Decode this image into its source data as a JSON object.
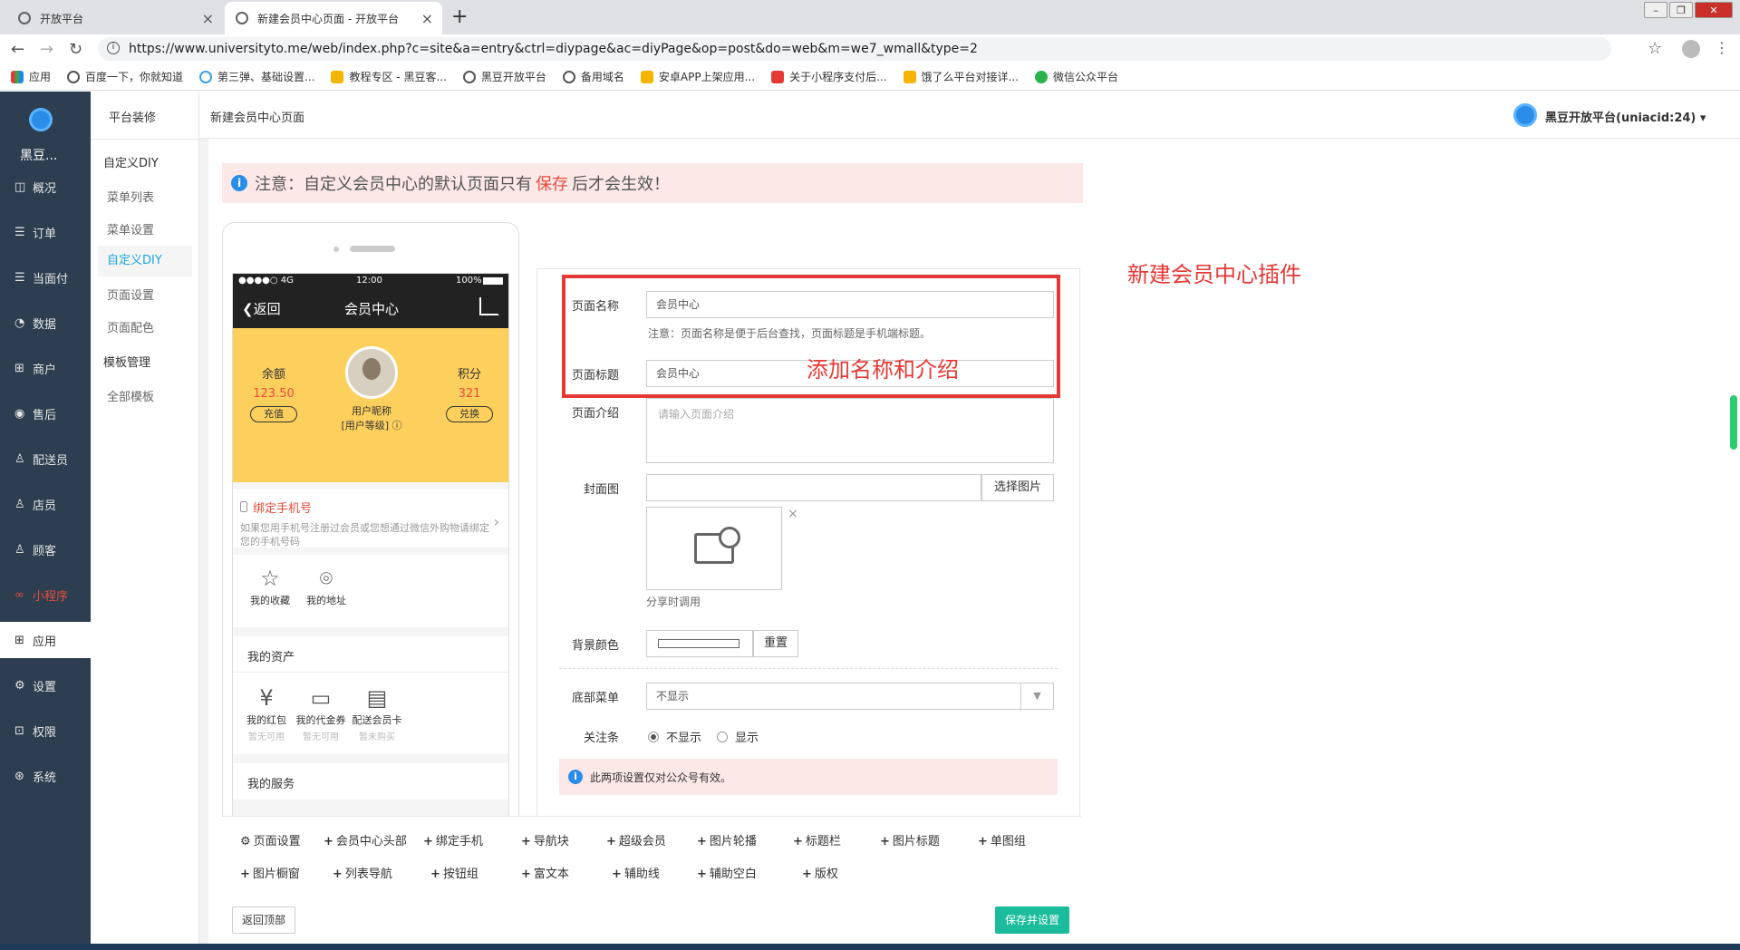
{
  "browser": {
    "tabs": [
      {
        "title": "开放平台"
      },
      {
        "title": "新建会员中心页面 - 开放平台"
      }
    ],
    "url": "https://www.universityto.me/web/index.php?c=site&a=entry&ctrl=diypage&ac=diyPage&op=post&do=web&m=we7_wmall&type=2",
    "bookmarks": [
      "应用",
      "百度一下，你就知道",
      "第三弹、基础设置...",
      "教程专区 - 黑豆客...",
      "黑豆开放平台",
      "备用域名",
      "安卓APP上架应用...",
      "关于小程序支付后...",
      "饿了么平台对接详...",
      "微信公众平台"
    ]
  },
  "sidebar": {
    "brand": "黑豆...",
    "items": [
      {
        "label": "概况",
        "icon": "◫"
      },
      {
        "label": "订单",
        "icon": "☰"
      },
      {
        "label": "当面付",
        "icon": "☰"
      },
      {
        "label": "数据",
        "icon": "◔"
      },
      {
        "label": "商户",
        "icon": "⊞"
      },
      {
        "label": "售后",
        "icon": "◉"
      },
      {
        "label": "配送员",
        "icon": "♙"
      },
      {
        "label": "店员",
        "icon": "♙"
      },
      {
        "label": "顾客",
        "icon": "♙"
      },
      {
        "label": "小程序",
        "icon": "∞"
      },
      {
        "label": "应用",
        "icon": "⊞"
      },
      {
        "label": "设置",
        "icon": "⚙"
      },
      {
        "label": "权限",
        "icon": "⊡"
      },
      {
        "label": "系统",
        "icon": "⊛"
      }
    ]
  },
  "subnav": {
    "title": "平台装修",
    "groups": [
      "自定义DIY",
      "模板管理"
    ],
    "items": [
      "菜单列表",
      "菜单设置",
      "自定义DIY",
      "页面设置",
      "页面配色",
      "全部模板"
    ]
  },
  "topbar": {
    "page_title": "新建会员中心页面",
    "user": "黑豆开放平台(uniacid:24)",
    "caret": "▾"
  },
  "notice": {
    "prefix": "注意：自定义会员中心的默认页面只有",
    "emphasis": "保存",
    "suffix": "后才会生效！"
  },
  "phone": {
    "status_left": "●●●●○ 4G",
    "status_time": "12:00",
    "status_right": "100%",
    "back": "❮返回",
    "title": "会员中心",
    "balance_label": "余额",
    "balance_value": "123.50",
    "recharge": "充值",
    "points_label": "积分",
    "points_value": "321",
    "exchange": "兑换",
    "nickname": "用户昵称",
    "level": "[用户等级] ⓘ",
    "bind_title": "绑定手机号",
    "bind_desc": "如果您用手机号注册过会员或您想通过微信外购物请绑定您的手机号码",
    "fav_items": [
      {
        "label": "我的收藏",
        "icon": "☆"
      },
      {
        "label": "我的地址",
        "icon": "⌾"
      }
    ],
    "assets_title": "我的资产",
    "assets": [
      {
        "label": "我的红包",
        "sub": "暂无可用",
        "icon": "¥"
      },
      {
        "label": "我的代金券",
        "sub": "暂无可用",
        "icon": "▭"
      },
      {
        "label": "配送会员卡",
        "sub": "暂未购买",
        "icon": "▤"
      }
    ],
    "services_title": "我的服务"
  },
  "form": {
    "name_label": "页面名称",
    "name_value": "会员中心",
    "name_hint": "注意：页面名称是便于后台查找，页面标题是手机端标题。",
    "title_label": "页面标题",
    "title_value": "会员中心",
    "intro_label": "页面介绍",
    "intro_placeholder": "请输入页面介绍",
    "cover_label": "封面图",
    "select_image": "选择图片",
    "cover_caption": "分享时调用",
    "bg_label": "背景颜色",
    "reset": "重置",
    "menu_label": "底部菜单",
    "menu_value": "不显示",
    "follow_label": "关注条",
    "follow_options": [
      "不显示",
      "显示"
    ],
    "tip": "此两项设置仅对公众号有效。"
  },
  "annotations": {
    "add_name": "添加名称和介绍",
    "plugin": "新建会员中心插件"
  },
  "components": {
    "row1": [
      "页面设置",
      "会员中心头部",
      "绑定手机",
      "导航块",
      "超级会员",
      "图片轮播",
      "标题栏",
      "图片标题",
      "单图组"
    ],
    "row2": [
      "图片橱窗",
      "列表导航",
      "按钮组",
      "富文本",
      "辅助线",
      "辅助空白",
      "版权"
    ]
  },
  "buttons": {
    "back_top": "返回顶部",
    "save": "保存并设置"
  },
  "colors": {
    "sidebar": "#2c3e50",
    "accent_yellow": "#fdd05e",
    "save_green": "#1abc9c",
    "annotation_red": "#e53935",
    "link_blue": "#1aa5df"
  }
}
